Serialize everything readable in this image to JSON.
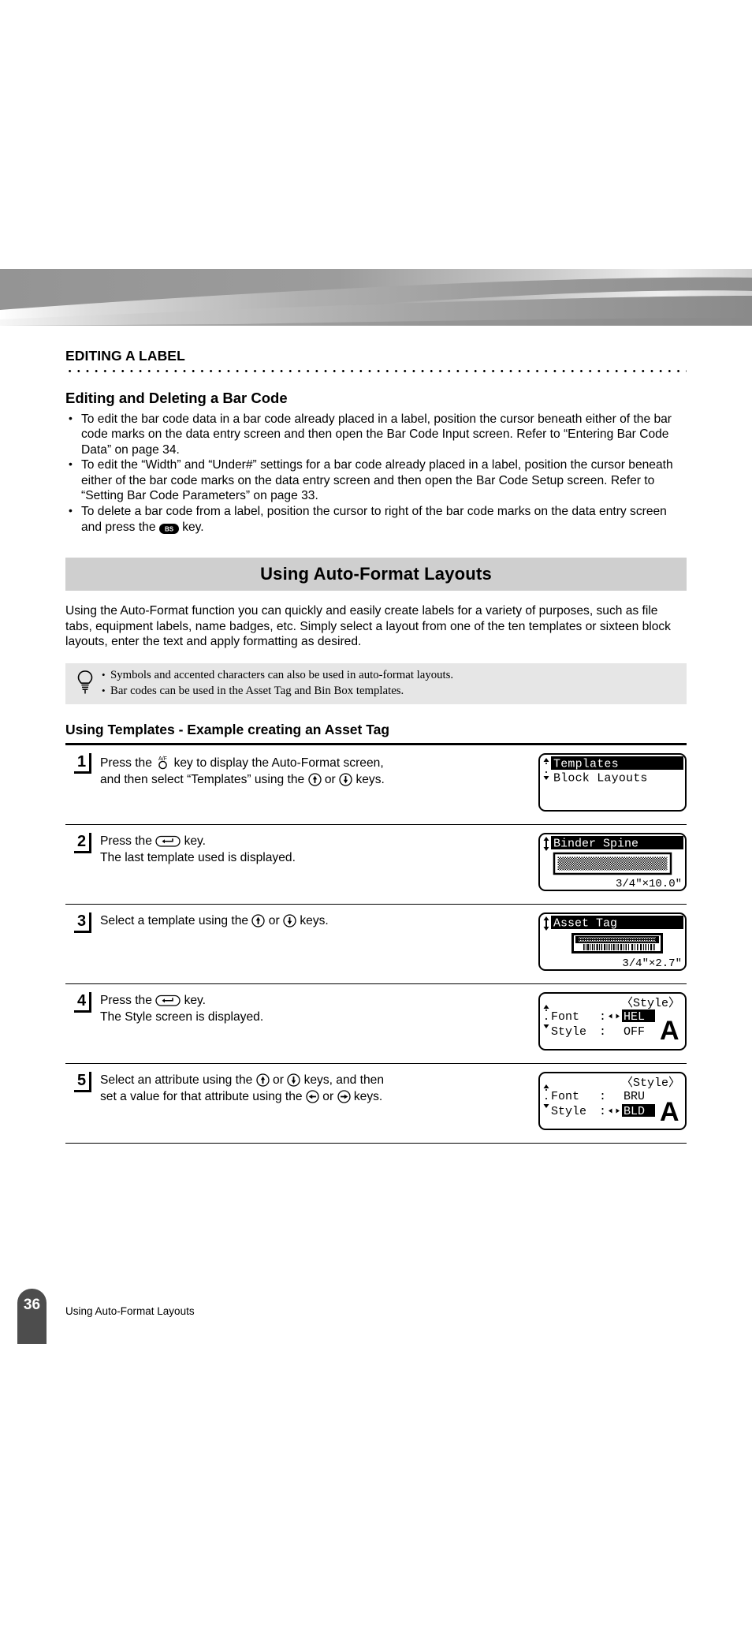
{
  "chapter": {
    "title": "EDITING A LABEL"
  },
  "section": {
    "heading": "Editing and Deleting a Bar Code",
    "bullets": [
      "To edit the bar code data in a bar code already placed in a label, position the cursor beneath either of the bar code marks on the data entry screen and then open the Bar Code Input screen. Refer to “Entering Bar Code Data” on page 34.",
      "To edit the “Width” and “Under#” settings for a bar code already placed in a label, position the cursor beneath either of the bar code marks on the data entry screen and then open the Bar Code Setup screen. Refer to “Setting Bar Code Parameters” on page 33.",
      "To delete a bar code from a label, position the cursor to right of the bar code marks on the data entry screen and press the"
    ],
    "bullet3_tail": "key.",
    "bs_key_label": "BS"
  },
  "band": {
    "title": "Using Auto-Format Layouts"
  },
  "intro": {
    "paragraph": "Using the Auto-Format function you can quickly and easily create labels for a variety of purposes, such as file tabs, equipment labels, name badges, etc. Simply select a layout from one of the ten templates or sixteen block layouts, enter the text and apply formatting as desired."
  },
  "note": {
    "icon": "lightbulb-icon",
    "items": [
      "Symbols and accented characters can also be used in auto-format layouts.",
      "Bar codes can be used in the Asset Tag and Bin Box templates."
    ]
  },
  "subsection": {
    "heading": "Using Templates - Example creating an Asset Tag"
  },
  "steps": [
    {
      "number": "1",
      "text_before_key": "Press the",
      "key": "af-key",
      "key_label": "A/F",
      "text_parts": [
        "key to display the Auto-Format screen,",
        "and then select “Templates” using the",
        "or",
        "keys."
      ],
      "lcd": {
        "type": "menu",
        "scroll": "up-down",
        "rows": [
          {
            "text": "Templates",
            "selected": true
          },
          {
            "text": "Block Layouts",
            "selected": false
          }
        ]
      }
    },
    {
      "number": "2",
      "text_before_key": "Press the",
      "key": "enter-key",
      "text_parts": [
        "key.",
        "The last template used is displayed."
      ],
      "lcd": {
        "type": "template-preview",
        "scroll": "up-down",
        "title": "Binder Spine",
        "size": "3/4\"×10.0\"",
        "preview": "dither-bar"
      }
    },
    {
      "number": "3",
      "text_parts": [
        "Select a template using the",
        "or",
        "keys."
      ],
      "lcd": {
        "type": "template-preview",
        "scroll": "up-down",
        "title": "Asset Tag",
        "size": "3/4\"×2.7\"",
        "preview": "asset-tag"
      }
    },
    {
      "number": "4",
      "text_before_key": "Press the",
      "key": "enter-key",
      "text_parts": [
        "key.",
        "The Style screen is displayed."
      ],
      "lcd": {
        "type": "style",
        "header": "〈Style〉",
        "rows": [
          {
            "label": "Font",
            "arrows": true,
            "value": "HEL",
            "selected": true
          },
          {
            "label": "Style",
            "arrows": false,
            "value": "OFF",
            "selected": false
          }
        ],
        "sample": "A"
      }
    },
    {
      "number": "5",
      "text_parts": [
        "Select an attribute using the",
        "or",
        "keys, and then",
        "set a value for that attribute using the",
        "or",
        "keys."
      ],
      "lcd": {
        "type": "style",
        "header": "〈Style〉",
        "rows": [
          {
            "label": "Font",
            "arrows": false,
            "value": "BRU",
            "selected": false
          },
          {
            "label": "Style",
            "arrows": true,
            "value": "BLD",
            "selected": true
          }
        ],
        "sample": "A"
      }
    }
  ],
  "footer": {
    "page_number": "36",
    "title": "Using Auto-Format Layouts"
  },
  "colors": {
    "band_bg": "#cfcfcf",
    "note_bg": "#e6e6e6",
    "page_tab": "#4d4d4d",
    "banner_dark": "#8f8f8f"
  }
}
